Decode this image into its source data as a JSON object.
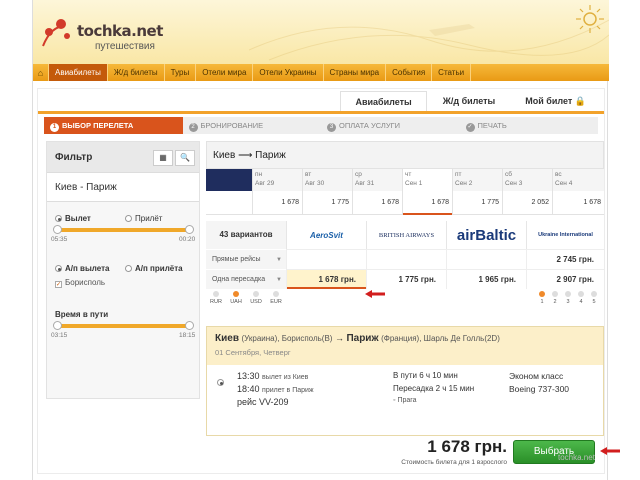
{
  "brand": {
    "name": "tochka.net",
    "subtitle": "путешествия"
  },
  "nav": {
    "home_icon": "home-icon",
    "items": [
      "Авиабилеты",
      "Ж/д билеты",
      "Туры",
      "Отели мира",
      "Отели Украины",
      "Страны мира",
      "События",
      "Статьи"
    ],
    "active_index": 0
  },
  "tabs": [
    "Авиабилеты",
    "Ж/д билеты",
    "Мой билет"
  ],
  "steps": [
    {
      "num": "1",
      "label": "ВЫБОР ПЕРЕЛЕТА"
    },
    {
      "num": "2",
      "label": "БРОНИРОВАНИЕ"
    },
    {
      "num": "3",
      "label": "ОПЛАТА УСЛУГИ"
    },
    {
      "num": "",
      "label": "ПЕЧАТЬ"
    }
  ],
  "filter": {
    "title": "Фильтр",
    "route": "Киев - Париж",
    "departure_label": "Вылет",
    "arrival_label": "Прилёт",
    "time_min": "05:35",
    "time_max": "00:20",
    "airport_depart_label": "А/п вылета",
    "airport_arrive_label": "А/п прилёта",
    "airport_option": "Борисполь",
    "travel_time_label": "Время в пути",
    "travel_min": "03:15",
    "travel_max": "18:15"
  },
  "route_header": "Киев ⟶ Париж",
  "dates": [
    {
      "wd": "пн",
      "date": "Авг 29",
      "price": "1 678"
    },
    {
      "wd": "вт",
      "date": "Авг 30",
      "price": "1 775"
    },
    {
      "wd": "ср",
      "date": "Авг 31",
      "price": "1 678"
    },
    {
      "wd": "чт",
      "date": "Сен 1",
      "price": "1 678"
    },
    {
      "wd": "пт",
      "date": "Сен 2",
      "price": "1 775"
    },
    {
      "wd": "сб",
      "date": "Сен 3",
      "price": "2 052"
    },
    {
      "wd": "вс",
      "date": "Сен 4",
      "price": "1 678"
    }
  ],
  "matrix": {
    "count": "43 вариантов",
    "airlines": [
      "AeroSvit",
      "BRITISH AIRWAYS",
      "airBaltic",
      "Ukraine International"
    ],
    "rows": [
      {
        "label": "Прямые рейсы",
        "cells": [
          "",
          "",
          "",
          "2 745 грн."
        ]
      },
      {
        "label": "Одна пересадка",
        "cells": [
          "1 678 грн.",
          "1 775 грн.",
          "1 965 грн.",
          "2 907 грн."
        ]
      }
    ],
    "currencies": [
      "RUR",
      "UAH",
      "USD",
      "EUR"
    ],
    "pages": [
      "1",
      "2",
      "3",
      "4",
      "5"
    ]
  },
  "flight": {
    "from": "Киев",
    "from_detail": "(Украина), Борисполь(B)",
    "to": "Париж",
    "to_detail": "(Франция), Шарль Де Голль(2D)",
    "date": "01 Сентября, Четверг",
    "dep_time": "13:30",
    "dep_text": "вылет из Киев",
    "arr_time": "18:40",
    "arr_text": "прилет в Париж",
    "flight_label": "рейс VV-209",
    "duration": "В пути 6 ч 10 мин",
    "transfer": "Пересадка 2 ч 15 мин",
    "via": "Прага",
    "class": "Эконом класс",
    "aircraft": "Boeing 737-300"
  },
  "total": {
    "price": "1 678 грн.",
    "note": "Стоимость билета для 1 взрослого"
  },
  "choose_label": "Выбрать",
  "watermark": "tochka.net",
  "colors": {
    "accent": "#d9541c",
    "nav": "#f0a82a",
    "button": "#2a8f28"
  }
}
